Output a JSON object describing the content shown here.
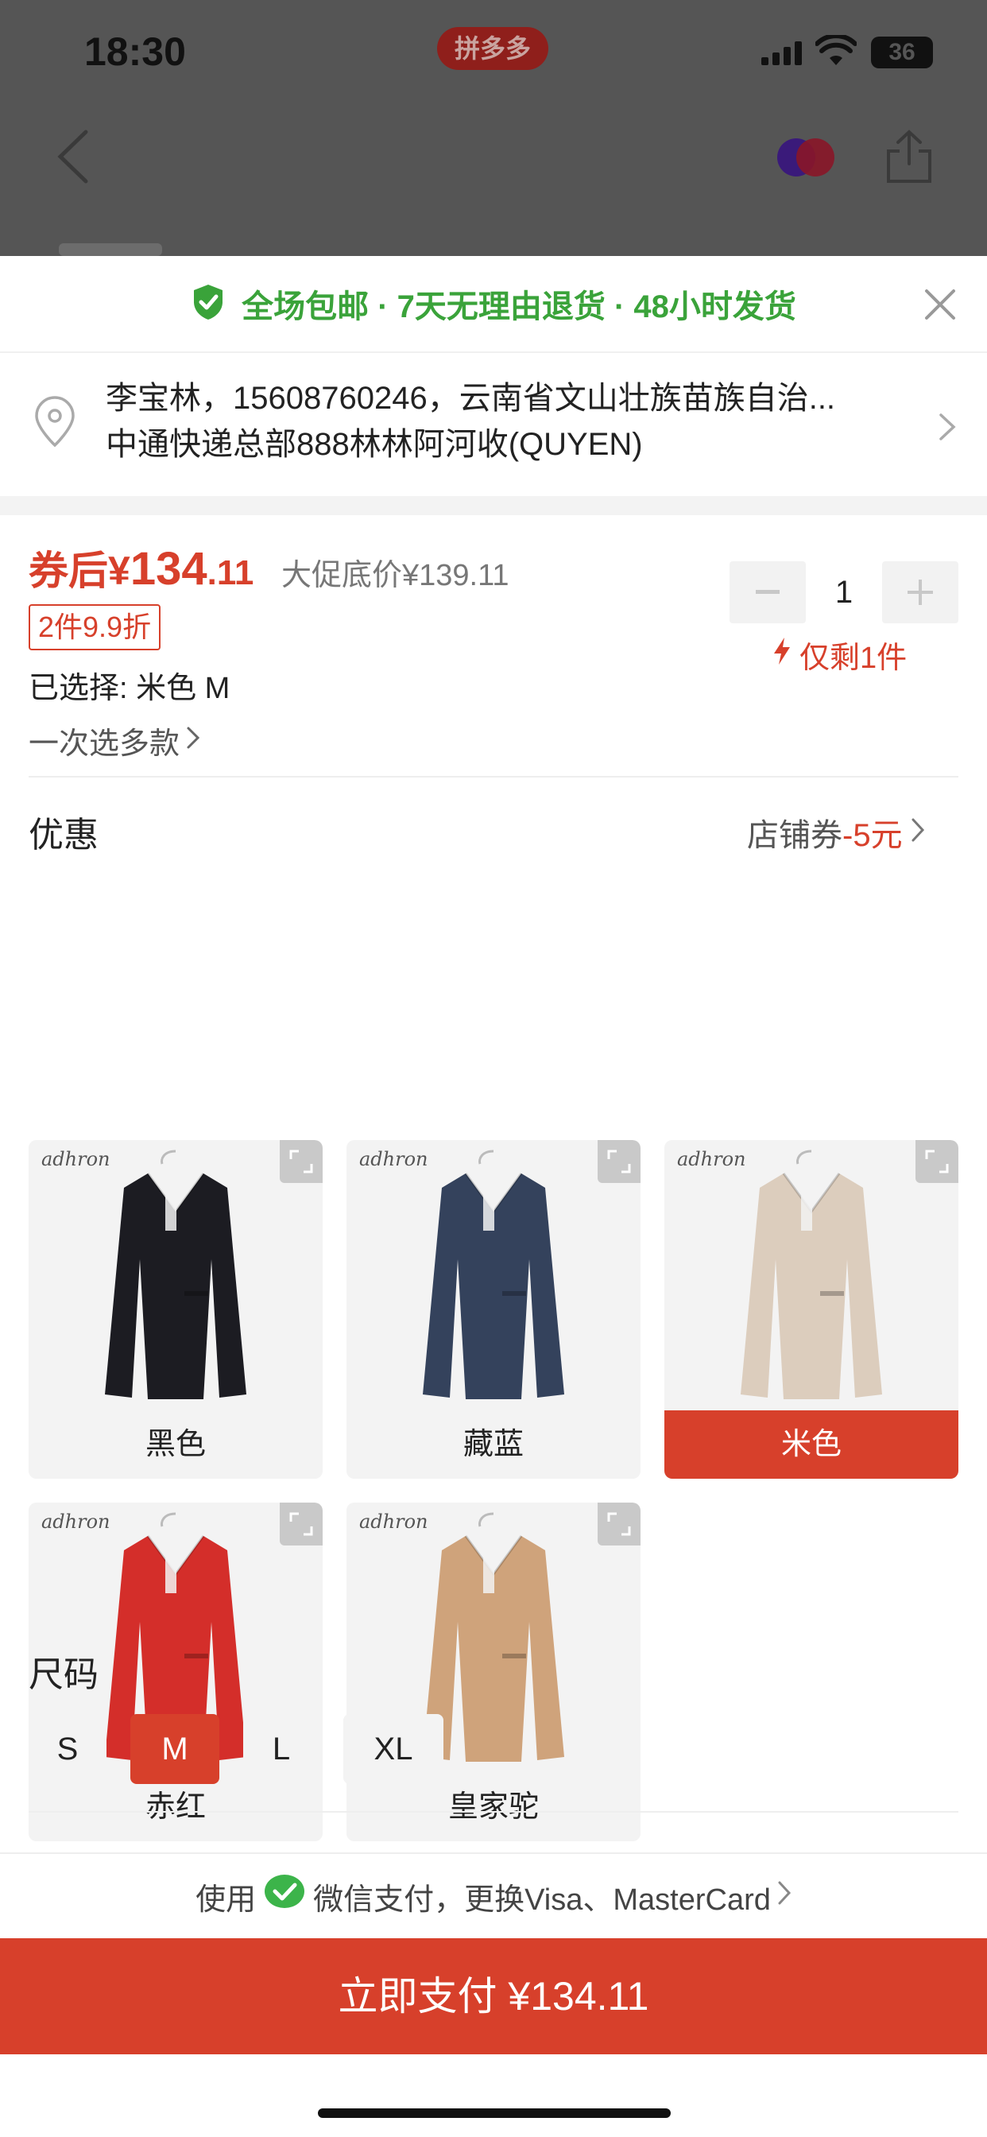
{
  "status_bar": {
    "time": "18:30",
    "app_badge": "拼多多",
    "battery": "36"
  },
  "promo": {
    "text": "全场包邮 · 7天无理由退货 · 48小时发货"
  },
  "address": {
    "line1": "李宝林，15608760246，云南省文山壮族苗族自治...",
    "line2": "中通快递总部888林林阿河收(QUYEN)"
  },
  "price": {
    "prefix": "券后¥",
    "integer": "134",
    "decimal": ".11",
    "original": "大促底价¥139.11",
    "discount_tag": "2件9.9折",
    "selected": "已选择: 米色 M",
    "multi_select": "一次选多款"
  },
  "quantity": {
    "value": "1",
    "stock": "仅剩1件"
  },
  "coupon": {
    "title": "优惠",
    "link_label": "店铺券",
    "link_amount": "-5元"
  },
  "colors": [
    {
      "label": "黑色",
      "coat": "#1c1c22",
      "selected": false
    },
    {
      "label": "藏蓝",
      "coat": "#34425c",
      "selected": false
    },
    {
      "label": "米色",
      "coat": "#dccdbd",
      "selected": true
    },
    {
      "label": "赤红",
      "coat": "#d42e2a",
      "selected": false
    },
    {
      "label": "皇家驼",
      "coat": "#cfa37b",
      "selected": false
    }
  ],
  "brand_mark": "adhron",
  "sizes": {
    "title": "尺码",
    "options": [
      "S",
      "M",
      "L",
      "XL"
    ],
    "selected": "M"
  },
  "payment": {
    "prefix": "使用",
    "method": "微信支付，更换Visa、MasterCard"
  },
  "pay_button": {
    "label": "立即支付 ¥134.11"
  },
  "theme": {
    "accent": "#d7402b",
    "green": "#3aa33a"
  }
}
